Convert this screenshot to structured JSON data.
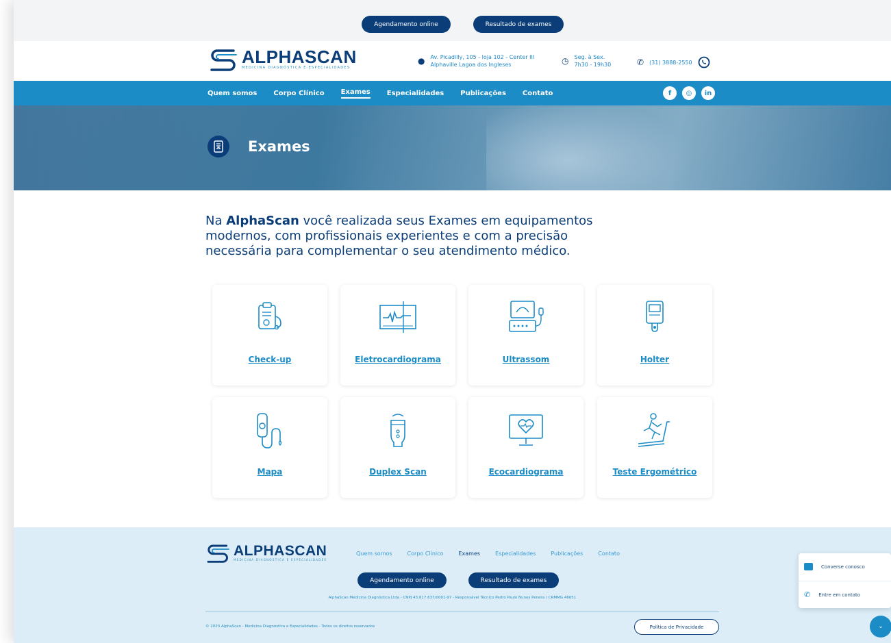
{
  "top": {
    "scheduling_label": "Agendamento online",
    "results_label": "Resultado de exames"
  },
  "header": {
    "logo_text": "ALPHASCAN",
    "logo_tagline": "MEDICINA DIAGNÓSTICA E ESPECIALIDADES",
    "address_line1": "Av. Picadilly, 105 - loja 102 - Center III",
    "address_line2": "Alphaville Lagoa dos Ingleses",
    "hours_line1": "Seg. à Sex.",
    "hours_line2": "7h30 - 19h30",
    "phone": "(31) 3888-2550",
    "icons": {
      "address": "map-pin-icon",
      "hours": "clock-icon",
      "phone": "phone-icon",
      "whatsapp": "whatsapp-icon"
    }
  },
  "nav": {
    "items": [
      {
        "label": "Quem somos",
        "active": false
      },
      {
        "label": "Corpo Clínico",
        "active": false
      },
      {
        "label": "Exames",
        "active": true
      },
      {
        "label": "Especialidades",
        "active": false
      },
      {
        "label": "Publicações",
        "active": false
      },
      {
        "label": "Contato",
        "active": false
      }
    ],
    "social": [
      "facebook-icon",
      "instagram-icon",
      "linkedin-icon"
    ]
  },
  "hero": {
    "title": "Exames"
  },
  "intro": {
    "brand": "AlphaScan",
    "prefix": "Na",
    "text": "você realizada seus Exames em equipamentos modernos, com profissionais experientes e com a precisão necessária para complementar o seu atendimento médico."
  },
  "exams": [
    {
      "label": "Check-up",
      "icon": "clipboard-stethoscope-icon"
    },
    {
      "label": "Eletrocardiograma",
      "icon": "ecg-monitor-icon"
    },
    {
      "label": "Ultrassom",
      "icon": "ultrasound-machine-icon"
    },
    {
      "label": "Holter",
      "icon": "holter-device-icon"
    },
    {
      "label": "Mapa",
      "icon": "blood-pressure-monitor-icon"
    },
    {
      "label": "Duplex Scan",
      "icon": "ultrasound-probe-icon"
    },
    {
      "label": "Ecocardiograma",
      "icon": "heart-monitor-icon"
    },
    {
      "label": "Teste Ergométrico",
      "icon": "treadmill-icon"
    }
  ],
  "footer": {
    "logo_text": "ALPHASCAN",
    "logo_tagline": "MEDICINA DIAGNÓSTICA E ESPECIALIDADES",
    "links": [
      {
        "label": "Quem somos",
        "active": false
      },
      {
        "label": "Corpo Clínico",
        "active": false
      },
      {
        "label": "Exames",
        "active": true
      },
      {
        "label": "Especialidades",
        "active": false
      },
      {
        "label": "Publicações",
        "active": false
      },
      {
        "label": "Contato",
        "active": false
      }
    ],
    "scheduling_label": "Agendamento online",
    "results_label": "Resultado de exames",
    "legal": "AlphaScan Medicina Diagnóstica Ltda - CNPJ 43.617.637/0001-97 - Responsável Técnico Pedro Paulo Nunes Pereira / CRMMG 46651",
    "copyright": "© 2023 AlphaScan - Medicina Diagnóstica e Especialidades - Todos os direitos reservados",
    "privacy_label": "Política de Privacidade"
  },
  "chat": {
    "talk_label": "Converse conosco",
    "contact_label": "Entre em contato"
  },
  "colors": {
    "navy": "#0b3e78",
    "blue": "#1c8cc7",
    "footer_bg": "#dcedf7"
  }
}
